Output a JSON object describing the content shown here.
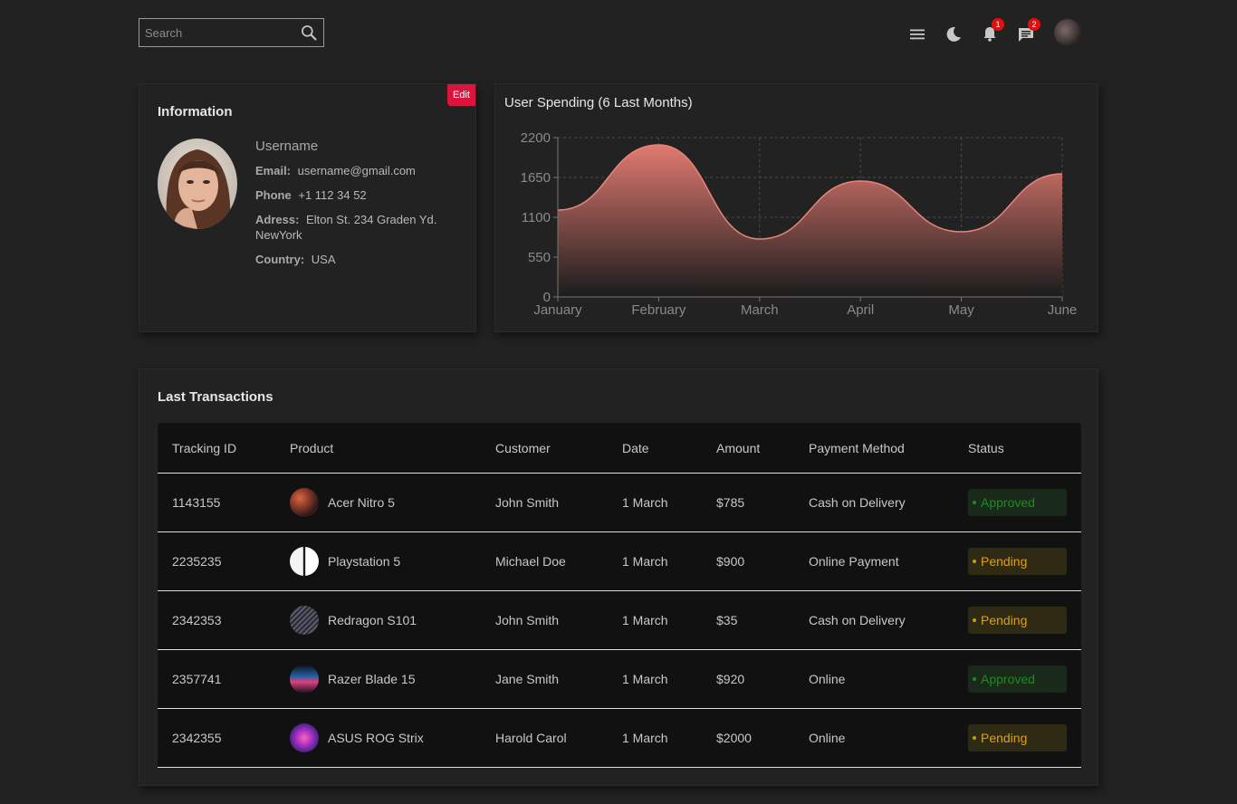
{
  "search": {
    "placeholder": "Search"
  },
  "topbar": {
    "notifications_count": "1",
    "messages_count": "2"
  },
  "info": {
    "title": "Information",
    "edit_label": "Edit",
    "username": "Username",
    "email_label": "Email:",
    "email": "username@gmail.com",
    "phone_label": "Phone",
    "phone": "+1 112 34 52",
    "address_label": "Adress:",
    "address": "Elton St. 234 Graden Yd. NewYork",
    "country_label": "Country:",
    "country": "USA"
  },
  "chart": {
    "title": "User Spending (6 Last Months)"
  },
  "chart_data": {
    "type": "area",
    "title": "User Spending (6 Last Months)",
    "categories": [
      "January",
      "February",
      "March",
      "April",
      "May",
      "June"
    ],
    "values": [
      1200,
      2100,
      800,
      1600,
      900,
      1700
    ],
    "y_ticks": [
      0,
      550,
      1100,
      1650,
      2200
    ],
    "ylim": [
      0,
      2200
    ],
    "grid": true,
    "colors": {
      "line": "#e8857a",
      "fill_top": "#e07a70",
      "fill_bottom": "#1c1c1c"
    }
  },
  "transactions": {
    "title": "Last Transactions",
    "headers": {
      "id": "Tracking ID",
      "product": "Product",
      "customer": "Customer",
      "date": "Date",
      "amount": "Amount",
      "payment": "Payment Method",
      "status": "Status"
    },
    "rows": [
      {
        "id": "1143155",
        "product": "Acer Nitro 5",
        "customer": "John Smith",
        "date": "1 March",
        "amount": "$785",
        "payment": "Cash on Delivery",
        "status": "Approved",
        "status_type": "approved"
      },
      {
        "id": "2235235",
        "product": "Playstation 5",
        "customer": "Michael Doe",
        "date": "1 March",
        "amount": "$900",
        "payment": "Online Payment",
        "status": "Pending",
        "status_type": "pending"
      },
      {
        "id": "2342353",
        "product": "Redragon S101",
        "customer": "John Smith",
        "date": "1 March",
        "amount": "$35",
        "payment": "Cash on Delivery",
        "status": "Pending",
        "status_type": "pending"
      },
      {
        "id": "2357741",
        "product": "Razer Blade 15",
        "customer": "Jane Smith",
        "date": "1 March",
        "amount": "$920",
        "payment": "Online",
        "status": "Approved",
        "status_type": "approved"
      },
      {
        "id": "2342355",
        "product": "ASUS ROG Strix",
        "customer": "Harold Carol",
        "date": "1 March",
        "amount": "$2000",
        "payment": "Online",
        "status": "Pending",
        "status_type": "pending"
      }
    ]
  }
}
